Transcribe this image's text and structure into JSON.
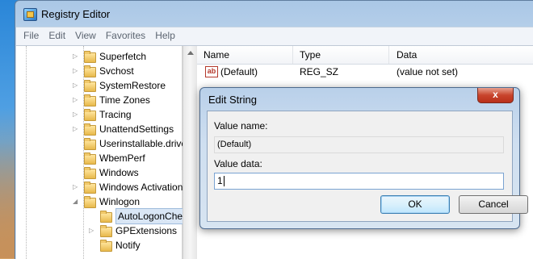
{
  "window": {
    "title": "Registry Editor",
    "icon": "registry-icon"
  },
  "menu": [
    "File",
    "Edit",
    "View",
    "Favorites",
    "Help"
  ],
  "tree": {
    "items": [
      {
        "label": "Superfetch",
        "expandable": true,
        "level": 0
      },
      {
        "label": "Svchost",
        "expandable": true,
        "level": 0
      },
      {
        "label": "SystemRestore",
        "expandable": true,
        "level": 0
      },
      {
        "label": "Time Zones",
        "expandable": true,
        "level": 0
      },
      {
        "label": "Tracing",
        "expandable": true,
        "level": 0
      },
      {
        "label": "UnattendSettings",
        "expandable": true,
        "level": 0
      },
      {
        "label": "Userinstallable.drive",
        "expandable": false,
        "level": 0
      },
      {
        "label": "WbemPerf",
        "expandable": false,
        "level": 0
      },
      {
        "label": "Windows",
        "expandable": false,
        "level": 0
      },
      {
        "label": "Windows Activation",
        "expandable": true,
        "level": 0
      },
      {
        "label": "Winlogon",
        "expandable": true,
        "expanded": true,
        "level": 0
      },
      {
        "label": "AutoLogonChec",
        "expandable": false,
        "level": 1,
        "selected": true
      },
      {
        "label": "GPExtensions",
        "expandable": true,
        "level": 1
      },
      {
        "label": "Notify",
        "expandable": false,
        "level": 1
      }
    ]
  },
  "list": {
    "columns": [
      "Name",
      "Type",
      "Data"
    ],
    "rows": [
      {
        "name": "(Default)",
        "type": "REG_SZ",
        "data": "(value not set)",
        "icon": "string-value-icon"
      }
    ]
  },
  "dialog": {
    "title": "Edit String",
    "close_label": "x",
    "value_name_label": "Value name:",
    "value_name": "(Default)",
    "value_data_label": "Value data:",
    "value_data": "1",
    "ok_label": "OK",
    "cancel_label": "Cancel"
  },
  "colors": {
    "accent": "#3c7fb1",
    "close_button": "#c8442c"
  }
}
